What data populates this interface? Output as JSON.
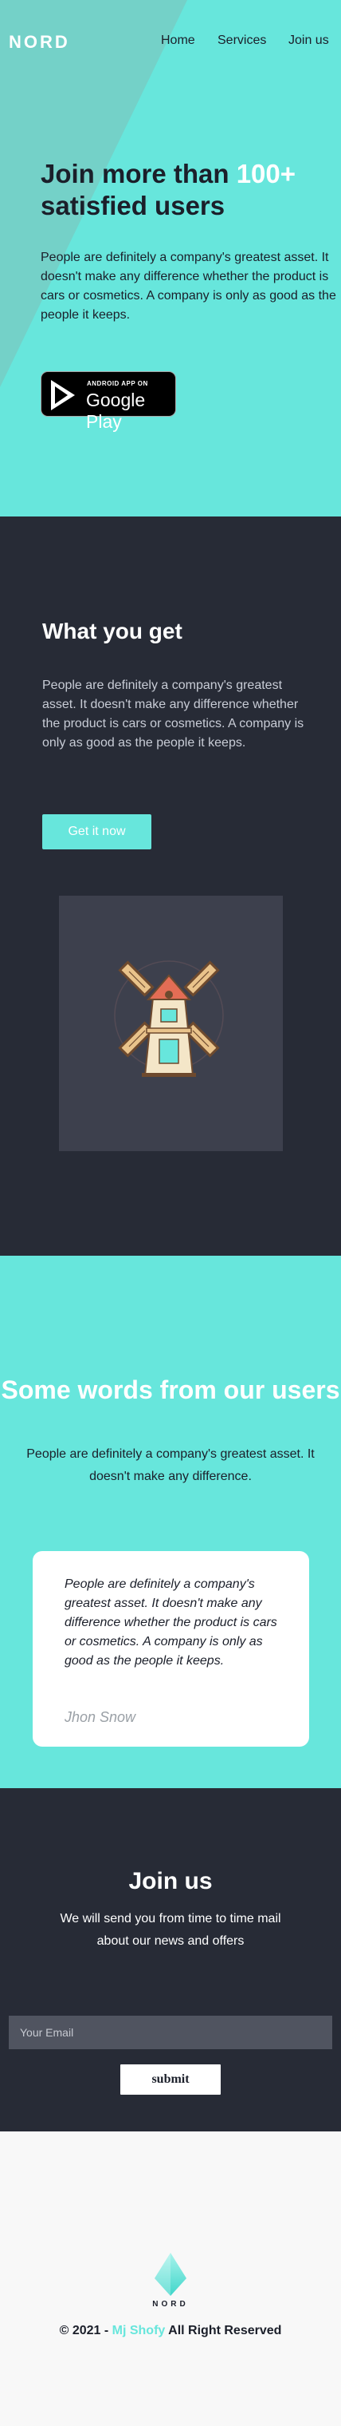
{
  "header": {
    "logo": "NORD",
    "nav": [
      "Home",
      "Services",
      "Join us"
    ]
  },
  "hero": {
    "title_pre": "Join more than ",
    "title_highlight": "100+",
    "title_post": " satisfied users",
    "text": "People are definitely a company's greatest asset. It doesn't make any difference whether the product is cars or cosmetics. A company is only as good as the people it keeps.",
    "store_badge": {
      "small": "ANDROID APP ON",
      "big": "Google Play"
    }
  },
  "features": {
    "title": "What you get",
    "text": "People are definitely a company's greatest asset. It doesn't make any difference whether the product is cars or cosmetics. A company is only as good as the people it keeps.",
    "cta_label": "Get it now",
    "illustration_icon": "windmill-icon"
  },
  "testimonials": {
    "title": "Some words from our users",
    "subtitle": "People are definitely a company's greatest asset. It doesn't make any difference.",
    "quote": "People are definitely a company's greatest asset. It doesn't make any difference whether the product is cars or cosmetics. A company is only as good as the people it keeps.",
    "author": "Jhon Snow"
  },
  "join": {
    "title": "Join us",
    "text": "We will send you from time to time mail about our news and offers",
    "email_placeholder": "Your Email",
    "submit_label": "submit"
  },
  "footer": {
    "logo": "NORD",
    "copyright_pre": "© 2021 - ",
    "author": "Mj Shofy",
    "copyright_post": " All Right Reserved"
  },
  "colors": {
    "accent": "#67e6dc",
    "dark": "#272b36",
    "text": "#1b1f2a"
  }
}
